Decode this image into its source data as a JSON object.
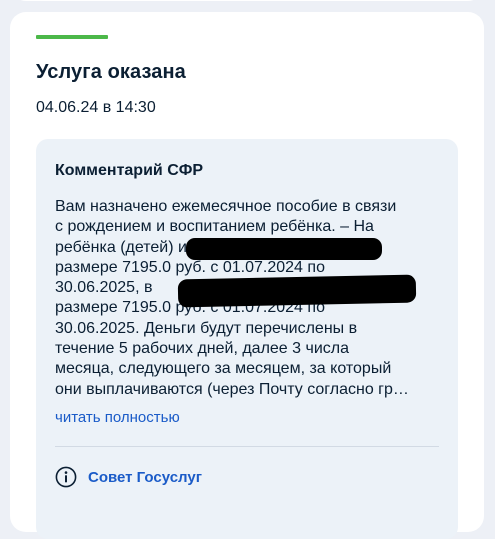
{
  "status": {
    "title": "Услуга оказана",
    "datetime": "04.06.24 в 14:30",
    "accent_color": "#4cb849"
  },
  "comment": {
    "title": "Комментарий СФР",
    "lines": [
      "Вам назначено ежемесячное пособие в связи",
      "с рождением и воспитанием ребёнка. – На",
      "ребёнка (детей)                                      ич в",
      "размере 7195.0 руб. с 01.07.2024 по",
      "30.06.2025,                                                    в",
      "размере 7195.0 руб. с 01.07.2024 по",
      "30.06.2025. Деньги будут перечислены в",
      "течение 5 рабочих дней, далее 3 числа",
      "месяца, следующего за месяцем, за который",
      "они выплачиваются (через Почту согласно гр…"
    ],
    "read_more_label": "читать полностью"
  },
  "advice": {
    "label": "Совет Госуслуг",
    "icon": "info-icon",
    "link_color": "#1a5bc8"
  }
}
